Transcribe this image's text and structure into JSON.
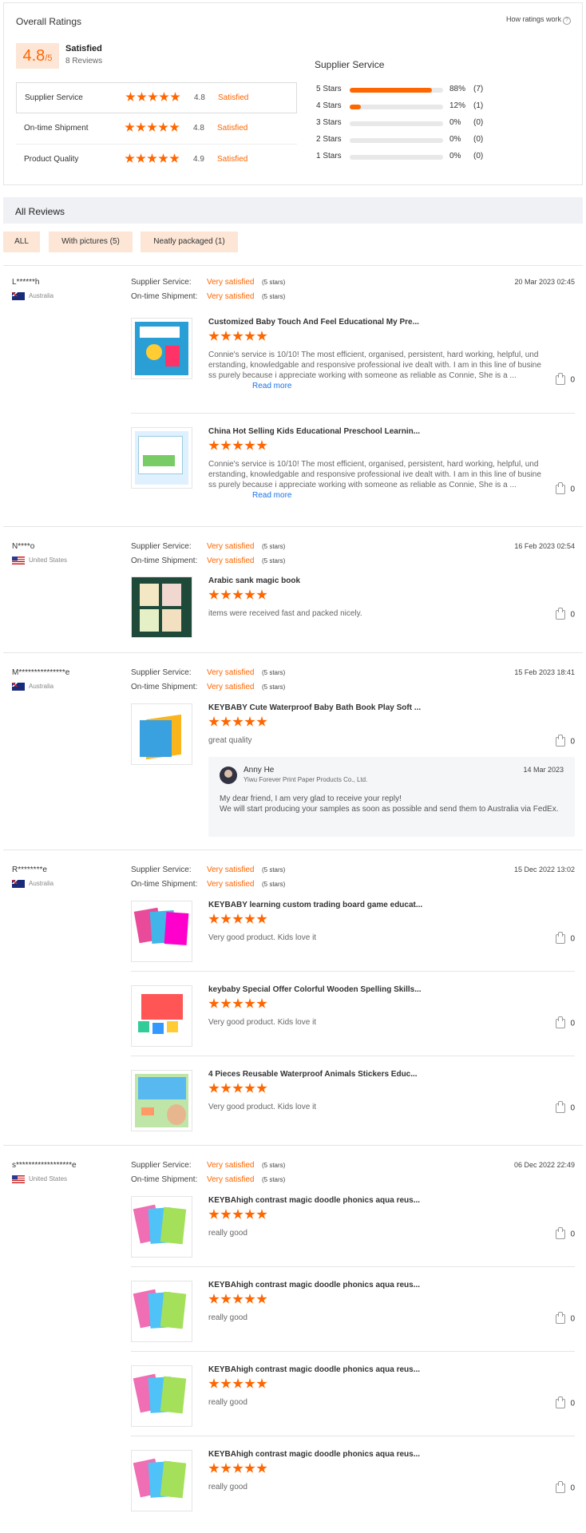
{
  "overall": {
    "title": "Overall Ratings",
    "how_link": "How ratings work",
    "score": "4.8",
    "score_max": "/5",
    "label": "Satisfied",
    "reviews": "8 Reviews",
    "rows": [
      {
        "label": "Supplier Service",
        "value": "4.8",
        "status": "Satisfied"
      },
      {
        "label": "On-time Shipment",
        "value": "4.8",
        "status": "Satisfied"
      },
      {
        "label": "Product Quality",
        "value": "4.9",
        "status": "Satisfied"
      }
    ]
  },
  "supplier": {
    "title": "Supplier Service",
    "bars": [
      {
        "label": "5 Stars",
        "pct": "88%",
        "count": "(7)",
        "fill": 0.88
      },
      {
        "label": "4 Stars",
        "pct": "12%",
        "count": "(1)",
        "fill": 0.12
      },
      {
        "label": "3 Stars",
        "pct": "0%",
        "count": "(0)",
        "fill": 0
      },
      {
        "label": "2 Stars",
        "pct": "0%",
        "count": "(0)",
        "fill": 0
      },
      {
        "label": "1 Stars",
        "pct": "0%",
        "count": "(0)",
        "fill": 0
      }
    ]
  },
  "all_reviews": {
    "title": "All Reviews",
    "filters": [
      "ALL",
      "With pictures (5)",
      "Neatly packaged (1)"
    ]
  },
  "labels": {
    "supplier_service": "Supplier Service:",
    "ontime": "On-time Shipment:",
    "very_satisfied": "Very satisfied",
    "five_stars": "(5 stars)",
    "read_more": "Read more"
  },
  "reviews": [
    {
      "user": "L******h",
      "country": "Australia",
      "date": "20 Mar 2023 02:45",
      "items": [
        {
          "title": "Customized Baby Touch And Feel Educational My Pre...",
          "text": "Connie's service is 10/10! The most efficient, organised, persistent, hard working, helpful, understanding, knowledgable and responsive professional ive dealt with. I am in this line of business purely because i appreciate working with someone as reliable as Connie, She is a ...",
          "likes": "0"
        },
        {
          "title": "China Hot Selling Kids Educational Preschool Learnin...",
          "text": "Connie's service is 10/10! The most efficient, organised, persistent, hard working, helpful, understanding, knowledgable and responsive professional ive dealt with. I am in this line of business purely because i appreciate working with someone as reliable as Connie, She is a ...",
          "likes": "0"
        }
      ]
    },
    {
      "user": "N****o",
      "country": "United States",
      "date": "16 Feb 2023 02:54",
      "items": [
        {
          "title": "Arabic sank magic book",
          "text": "items were received fast and packed nicely.",
          "likes": "0"
        }
      ]
    },
    {
      "user": "M***************e",
      "country": "Australia",
      "date": "15 Feb 2023 18:41",
      "items": [
        {
          "title": "KEYBABY Cute Waterproof Baby Bath Book Play Soft ...",
          "text": "great quality",
          "likes": "0"
        }
      ],
      "reply": {
        "name": "Anny He",
        "company": "Yiwu Forever Print Paper Products Co., Ltd.",
        "date": "14 Mar 2023",
        "text": "My dear friend, I am very glad to receive your reply!\nWe will start producing your samples as soon as possible and send them to Australia via FedEx."
      }
    },
    {
      "user": "R********e",
      "country": "Australia",
      "date": "15 Dec 2022 13:02",
      "items": [
        {
          "title": "KEYBABY learning custom trading board game educat...",
          "text": "Very good product. Kids love it",
          "likes": "0"
        },
        {
          "title": "keybaby Special Offer Colorful Wooden Spelling Skills...",
          "text": "Very good product. Kids love it",
          "likes": "0"
        },
        {
          "title": "4 Pieces Reusable Waterproof Animals Stickers Educ...",
          "text": "Very good product. Kids love it",
          "likes": "0"
        }
      ]
    },
    {
      "user": "s******************e",
      "country": "United States",
      "date": "06 Dec 2022 22:49",
      "items": [
        {
          "title": "KEYBAhigh contrast magic doodle phonics aqua reus...",
          "text": "really good",
          "likes": "0"
        },
        {
          "title": "KEYBAhigh contrast magic doodle phonics aqua reus...",
          "text": "really good",
          "likes": "0"
        },
        {
          "title": "KEYBAhigh contrast magic doodle phonics aqua reus...",
          "text": "really good",
          "likes": "0"
        },
        {
          "title": "KEYBAhigh contrast magic doodle phonics aqua reus...",
          "text": "really good",
          "likes": "0"
        }
      ]
    }
  ]
}
